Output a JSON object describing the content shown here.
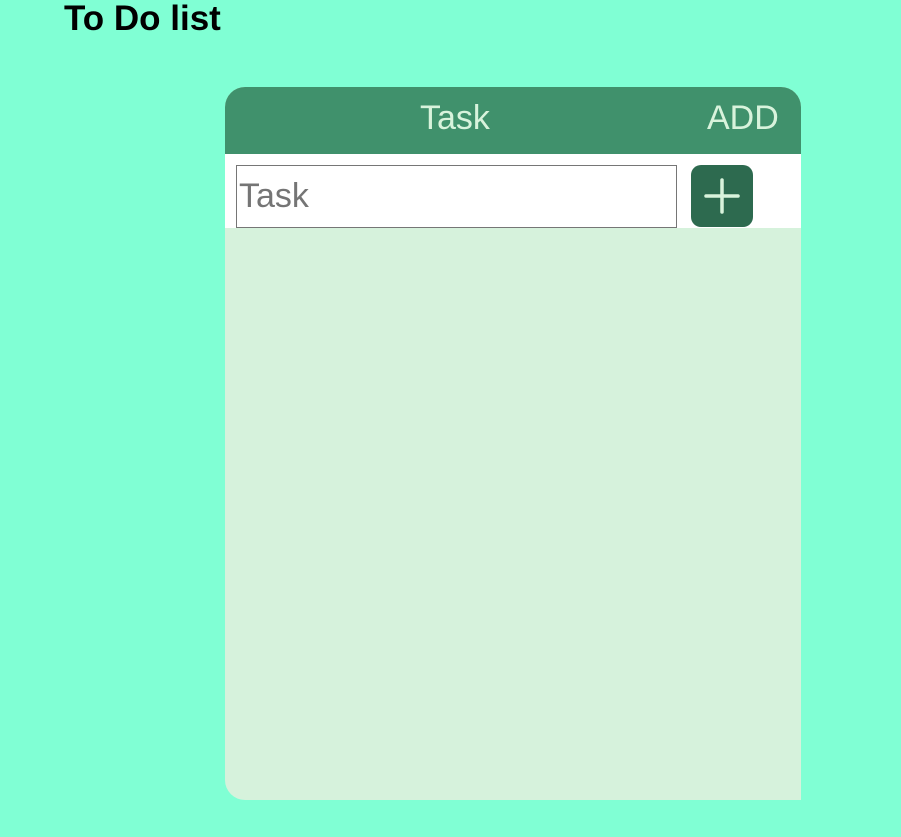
{
  "page": {
    "title": "To Do list"
  },
  "todo": {
    "header": {
      "task_label": "Task",
      "add_label": "ADD"
    },
    "input": {
      "placeholder": "Task",
      "value": ""
    },
    "add_button": {
      "icon": "plus-icon"
    },
    "tasks": []
  },
  "colors": {
    "page_background": "#80ffd4",
    "header_background": "#40916c",
    "header_text": "#d8f3dc",
    "list_background": "#d6f2dc",
    "button_background": "#2d6a4f",
    "button_icon": "#d8f3dc"
  }
}
